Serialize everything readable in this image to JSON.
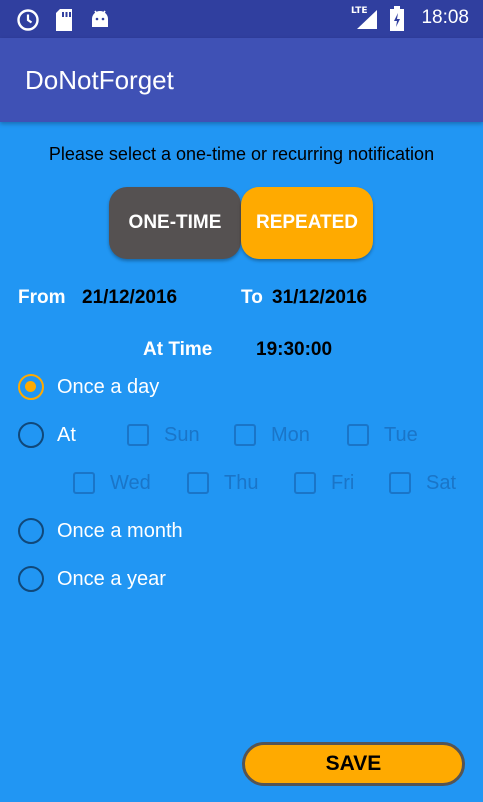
{
  "status_bar": {
    "time": "18:08",
    "network": "LTE",
    "icons": [
      "clock-icon",
      "sd-card-icon",
      "android-icon",
      "signal-icon",
      "battery-icon"
    ]
  },
  "app": {
    "title": "DoNotForget"
  },
  "prompt": "Please select a one-time or recurring notification",
  "toggle": {
    "one_time": "ONE-TIME",
    "repeated": "REPEATED",
    "selected": "REPEATED"
  },
  "dates": {
    "from_label": "From",
    "from_value": "21/12/2016",
    "to_label": "To",
    "to_value": "31/12/2016"
  },
  "time": {
    "label": "At Time",
    "value": "19:30:00"
  },
  "options": {
    "once_a_day": "Once a day",
    "at": "At",
    "once_a_month": "Once a month",
    "once_a_year": "Once a year",
    "selected": "Once a day"
  },
  "days": {
    "sun": "Sun",
    "mon": "Mon",
    "tue": "Tue",
    "wed": "Wed",
    "thu": "Thu",
    "fri": "Fri",
    "sat": "Sat"
  },
  "save_label": "SAVE",
  "colors": {
    "background": "#2196f3",
    "status_bar": "#303f9f",
    "app_bar": "#3f51b5",
    "accent": "#ffaa00",
    "dark_toggle": "#555151"
  }
}
